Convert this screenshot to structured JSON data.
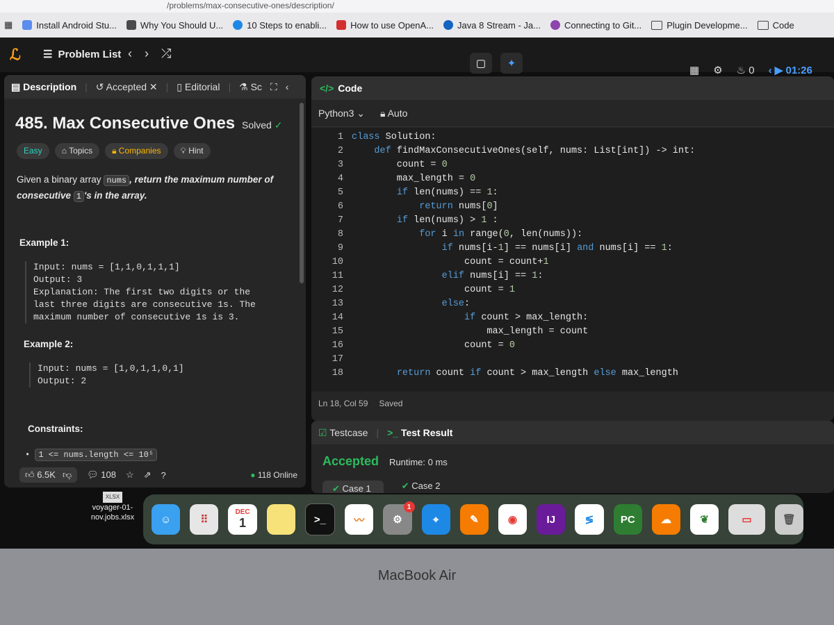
{
  "browser": {
    "url_fragment": "/problems/max-consecutive-ones/description/",
    "bookmarks": [
      "Install Android Stu...",
      "Why You Should U...",
      "10 Steps to enabli...",
      "How to use OpenA...",
      "Java 8 Stream - Ja...",
      "Connecting to Git...",
      "Plugin Developme...",
      "Code"
    ]
  },
  "nav": {
    "problem_list": "Problem List",
    "fire_count": "0",
    "timer": "01:26"
  },
  "left": {
    "tabs": [
      "Description",
      "Accepted",
      "Editorial",
      "Sc"
    ],
    "title": "485. Max Consecutive Ones",
    "solved": "Solved",
    "chips": [
      "Easy",
      "Topics",
      "Companies",
      "Hint"
    ],
    "desc_pre": "Given a binary array ",
    "desc_code1": "nums",
    "desc_mid": ", return the maximum number of consecutive ",
    "desc_code2": "1",
    "desc_post": "'s in the array.",
    "ex1_title": "Example 1:",
    "ex1_body": "Input: nums = [1,1,0,1,1,1]\nOutput: 3\nExplanation: The first two digits or the\nlast three digits are consecutive 1s. The\nmaximum number of consecutive 1s is 3.",
    "ex2_title": "Example 2:",
    "ex2_body": "Input: nums = [1,0,1,1,0,1]\nOutput: 2",
    "constraints_title": "Constraints:",
    "constraint1": "1 <= nums.length <= 10⁵",
    "likes": "6.5K",
    "comments": "108",
    "online": "118 Online"
  },
  "code": {
    "header": "Code",
    "language": "Python3",
    "auto": "Auto",
    "status_pos": "Ln 18, Col 59",
    "status_saved": "Saved",
    "lines": [
      "class Solution:",
      "    def findMaxConsecutiveOnes(self, nums: List[int]) -> int:",
      "        count = 0",
      "        max_length = 0",
      "        if len(nums) == 1:",
      "            return nums[0]",
      "        if len(nums) > 1 :",
      "            for i in range(0, len(nums)):",
      "                if nums[i-1] == nums[i] and nums[i] == 1:",
      "                    count = count+1",
      "                elif nums[i] == 1:",
      "                    count = 1",
      "                else:",
      "                    if count > max_length:",
      "                        max_length = count",
      "                    count = 0",
      "",
      "        return count if count > max_length else max_length"
    ]
  },
  "test": {
    "tabs": [
      "Testcase",
      "Test Result"
    ],
    "result": "Accepted",
    "runtime": "Runtime: 0 ms",
    "cases": [
      "Case 1",
      "Case 2"
    ]
  },
  "desktop": {
    "file_badge": "XLSX",
    "file_name": "voyager-01-nov.jobs.xlsx",
    "calendar_month": "DEC",
    "calendar_day": "1",
    "settings_badge": "1",
    "laptop_label": "MacBook Air"
  }
}
